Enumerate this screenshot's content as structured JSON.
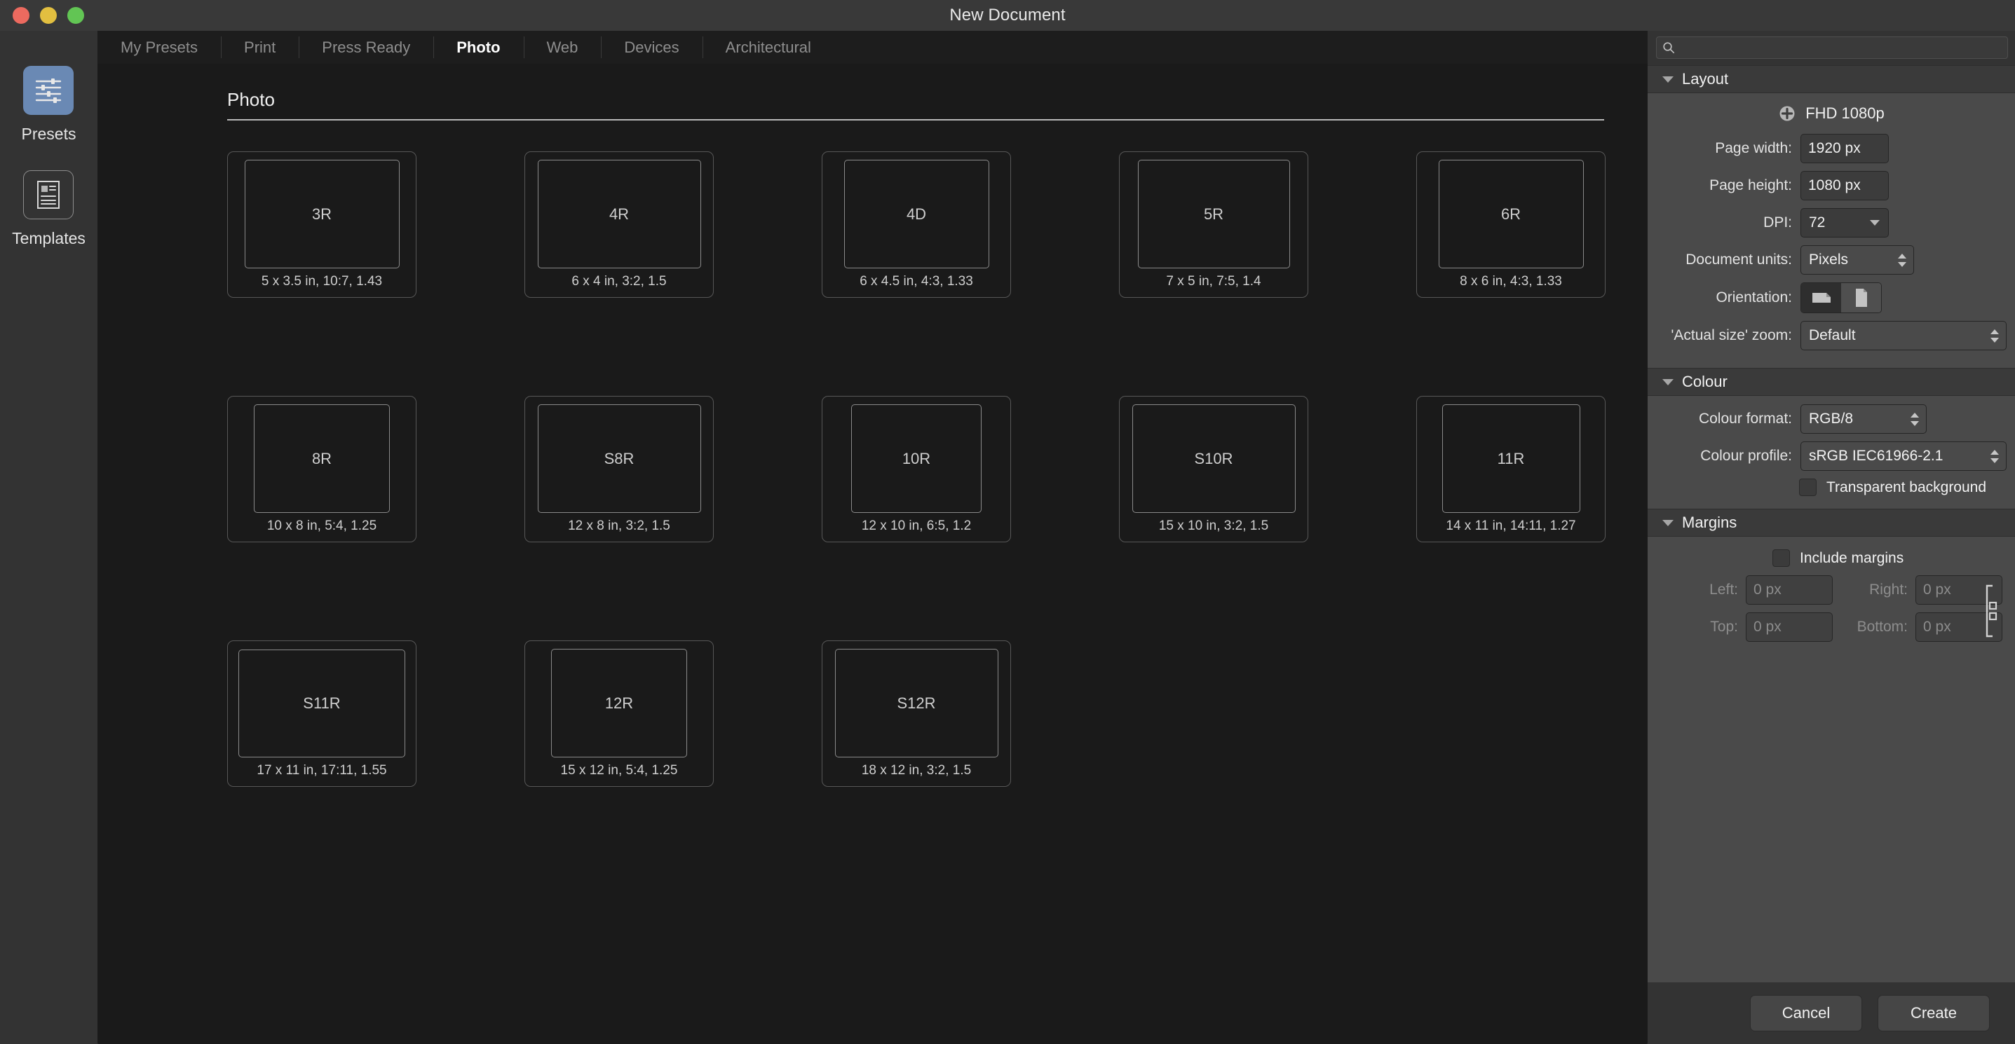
{
  "window": {
    "title": "New Document",
    "traffic_lights": [
      "close",
      "minimize",
      "zoom"
    ]
  },
  "sidebar": {
    "items": [
      {
        "label": "Presets",
        "icon": "sliders-icon",
        "active": true
      },
      {
        "label": "Templates",
        "icon": "document-template-icon",
        "active": false
      }
    ]
  },
  "tabs": [
    {
      "label": "My Presets",
      "active": false
    },
    {
      "label": "Print",
      "active": false
    },
    {
      "label": "Press Ready",
      "active": false
    },
    {
      "label": "Photo",
      "active": true
    },
    {
      "label": "Web",
      "active": false
    },
    {
      "label": "Devices",
      "active": false
    },
    {
      "label": "Architectural",
      "active": false
    }
  ],
  "main": {
    "section_title": "Photo",
    "presets": [
      {
        "name": "3R",
        "caption": "5 x 3.5 in, 10:7, 1.43",
        "w": 5,
        "h": 3.5
      },
      {
        "name": "4R",
        "caption": "6 x 4 in, 3:2, 1.5",
        "w": 6,
        "h": 4
      },
      {
        "name": "4D",
        "caption": "6 x 4.5 in, 4:3, 1.33",
        "w": 6,
        "h": 4.5
      },
      {
        "name": "5R",
        "caption": "7 x 5 in, 7:5, 1.4",
        "w": 7,
        "h": 5
      },
      {
        "name": "6R",
        "caption": "8 x 6 in, 4:3, 1.33",
        "w": 8,
        "h": 6
      },
      {
        "name": "8R",
        "caption": "10 x 8 in, 5:4, 1.25",
        "w": 10,
        "h": 8
      },
      {
        "name": "S8R",
        "caption": "12 x 8 in, 3:2, 1.5",
        "w": 12,
        "h": 8
      },
      {
        "name": "10R",
        "caption": "12 x 10 in, 6:5, 1.2",
        "w": 12,
        "h": 10
      },
      {
        "name": "S10R",
        "caption": "15 x 10 in, 3:2, 1.5",
        "w": 15,
        "h": 10
      },
      {
        "name": "11R",
        "caption": "14 x 11 in, 14:11, 1.27",
        "w": 14,
        "h": 11
      },
      {
        "name": "S11R",
        "caption": "17 x 11 in, 17:11, 1.55",
        "w": 17,
        "h": 11
      },
      {
        "name": "12R",
        "caption": "15 x 12 in, 5:4, 1.25",
        "w": 15,
        "h": 12
      },
      {
        "name": "S12R",
        "caption": "18 x 12 in, 3:2, 1.5",
        "w": 18,
        "h": 12
      }
    ]
  },
  "inspector": {
    "search": {
      "value": "",
      "placeholder": "",
      "icon": "search-icon"
    },
    "layout": {
      "title": "Layout",
      "preset_name": "FHD 1080p",
      "add_icon": "plus-circle-icon",
      "page_width_label": "Page width:",
      "page_width_value": "1920 px",
      "page_height_label": "Page height:",
      "page_height_value": "1080 px",
      "dpi_label": "DPI:",
      "dpi_value": "72",
      "units_label": "Document units:",
      "units_value": "Pixels",
      "orientation_label": "Orientation:",
      "orientation_selected": "landscape",
      "actual_size_label": "'Actual size' zoom:",
      "actual_size_value": "Default"
    },
    "colour": {
      "title": "Colour",
      "format_label": "Colour format:",
      "format_value": "RGB/8",
      "profile_label": "Colour profile:",
      "profile_value": "sRGB IEC61966-2.1",
      "transparent_label": "Transparent background",
      "transparent_checked": false
    },
    "margins": {
      "title": "Margins",
      "include_label": "Include margins",
      "include_checked": false,
      "left_label": "Left:",
      "left_value": "0 px",
      "right_label": "Right:",
      "right_value": "0 px",
      "top_label": "Top:",
      "top_value": "0 px",
      "bottom_label": "Bottom:",
      "bottom_value": "0 px",
      "link_icon": "link-chain-icon"
    }
  },
  "footer": {
    "cancel_label": "Cancel",
    "create_label": "Create"
  },
  "colors": {
    "accent": "#6a89b4",
    "window_chrome": "#393939",
    "canvas": "#1a1a1a",
    "panel": "#4a4a4a",
    "traffic_red": "#ec6a5f",
    "traffic_yellow": "#e2bf40",
    "traffic_green": "#62c554"
  }
}
